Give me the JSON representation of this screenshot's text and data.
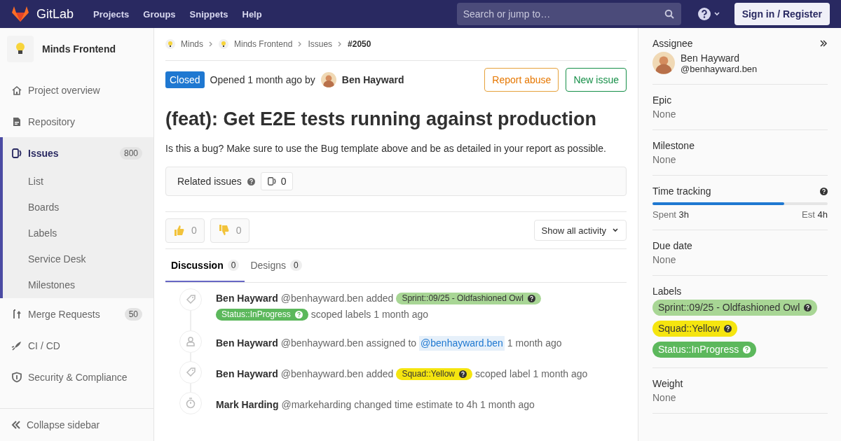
{
  "navbar": {
    "brand": "GitLab",
    "links": [
      "Projects",
      "Groups",
      "Snippets",
      "Help"
    ],
    "search": {
      "placeholder": "Search or jump to…"
    },
    "sign_in": "Sign in / Register"
  },
  "sidebar": {
    "project": "Minds Frontend",
    "items": [
      {
        "label": "Project overview",
        "selected": false
      },
      {
        "label": "Repository",
        "selected": false
      },
      {
        "label": "Issues",
        "selected": true,
        "badge": "800",
        "children": [
          {
            "label": "List"
          },
          {
            "label": "Boards"
          },
          {
            "label": "Labels"
          },
          {
            "label": "Service Desk"
          },
          {
            "label": "Milestones"
          }
        ]
      },
      {
        "label": "Merge Requests",
        "selected": false,
        "badge": "50"
      },
      {
        "label": "CI / CD",
        "selected": false
      },
      {
        "label": "Security & Compliance",
        "selected": false
      }
    ],
    "collapse": "Collapse sidebar"
  },
  "breadcrumbs": [
    {
      "label": "Minds"
    },
    {
      "label": "Minds Frontend"
    },
    {
      "label": "Issues"
    },
    {
      "label": "#2050"
    }
  ],
  "issue": {
    "status": "Closed",
    "opened": "Opened 1 month ago by",
    "author": "Ben Hayward",
    "buttons": [
      {
        "label": "Report abuse",
        "kind": "warning"
      },
      {
        "label": "New issue",
        "kind": "success"
      }
    ],
    "title": "(feat): Get E2E tests running against production",
    "description": "Is this a bug? Make sure to use the Bug template above and be as detailed in your report as possible.",
    "related": {
      "label": "Related issues",
      "count": "0"
    },
    "awards": [
      {
        "kind": "thumbsup",
        "count": "0"
      },
      {
        "kind": "thumbsdown",
        "count": "0"
      }
    ],
    "activity_filter": "Show all activity",
    "tabs": [
      {
        "label": "Discussion",
        "count": "0",
        "selected": true
      },
      {
        "label": "Designs",
        "count": "0",
        "selected": false
      }
    ],
    "events": [
      {
        "kind": "tag",
        "author": "Ben Hayward",
        "handle": "@benhayward.ben",
        "parts": [
          {
            "kind": "text",
            "text": "added"
          },
          {
            "kind": "label",
            "text": "Sprint::09/25 - Oldfashioned Owl",
            "color": "#a8d695"
          },
          {
            "kind": "label",
            "text": "Status::InProgress",
            "color": "#5cb85c"
          },
          {
            "kind": "text",
            "text": "scoped labels 1 month ago"
          }
        ]
      },
      {
        "kind": "assign",
        "author": "Ben Hayward",
        "handle": "@benhayward.ben",
        "parts": [
          {
            "kind": "text",
            "text": "assigned to"
          },
          {
            "kind": "mention",
            "text": "@benhayward.ben"
          },
          {
            "kind": "text",
            "text": "1 month ago"
          }
        ]
      },
      {
        "kind": "tag",
        "author": "Ben Hayward",
        "handle": "@benhayward.ben",
        "parts": [
          {
            "kind": "text",
            "text": "added"
          },
          {
            "kind": "label",
            "text": "Squad::Yellow",
            "color": "#f5e50f"
          },
          {
            "kind": "text",
            "text": "scoped label 1 month ago"
          }
        ]
      },
      {
        "kind": "time",
        "author": "Mark Harding",
        "handle": "@markeharding",
        "parts": [
          {
            "kind": "text",
            "text": "changed time estimate to 4h 1 month ago"
          }
        ]
      }
    ]
  },
  "right_sidebar": {
    "assignee": {
      "title": "Assignee",
      "name": "Ben Hayward",
      "handle": "@benhayward.ben"
    },
    "sections": [
      {
        "title": "Epic",
        "value": "None"
      },
      {
        "title": "Milestone",
        "value": "None"
      }
    ],
    "time_tracking": {
      "title": "Time tracking",
      "level": 0.75,
      "spent_label": "Spent",
      "spent": "3h",
      "est_label": "Est",
      "est": "4h"
    },
    "due_date": {
      "title": "Due date",
      "value": "None"
    },
    "labels": {
      "title": "Labels",
      "items": [
        {
          "text": "Sprint::09/25 - Oldfashioned Owl",
          "color": "#a8d695"
        },
        {
          "text": "Squad::Yellow",
          "color": "#f5e50f"
        },
        {
          "text": "Status::InProgress",
          "color": "#5cb85c"
        }
      ]
    },
    "weight": {
      "title": "Weight",
      "value": "None"
    }
  }
}
